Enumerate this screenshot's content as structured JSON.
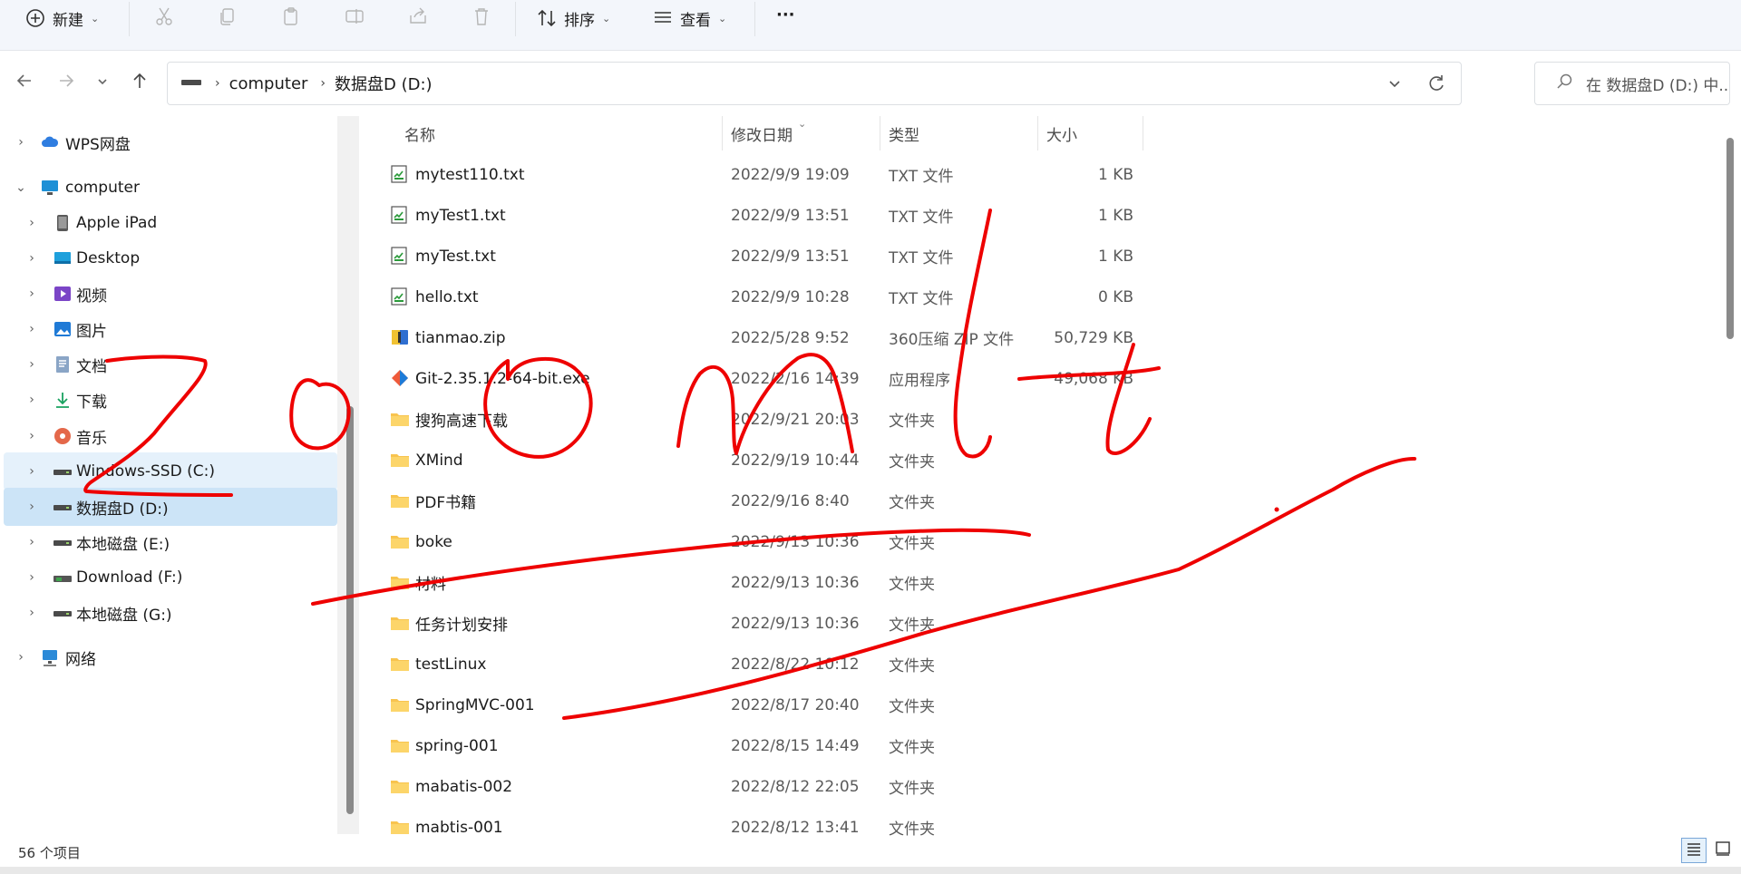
{
  "toolbar": {
    "new_label": "新建",
    "sort_label": "排序",
    "view_label": "查看",
    "more_label": "···"
  },
  "address": {
    "crumbs": [
      "computer",
      "数据盘D (D:)"
    ]
  },
  "search": {
    "placeholder": "在 数据盘D (D:) 中..."
  },
  "sidebar": {
    "items": [
      {
        "label": "WPS网盘",
        "icon": "cloud-icon",
        "level": 0,
        "chevron": "›"
      },
      {
        "label": "computer",
        "icon": "monitor-icon",
        "level": 0,
        "chevron": "⌄"
      },
      {
        "label": "Apple iPad",
        "icon": "ipad-icon",
        "level": 1,
        "chevron": "›"
      },
      {
        "label": "Desktop",
        "icon": "desktop-icon",
        "level": 1,
        "chevron": "›"
      },
      {
        "label": "视频",
        "icon": "video-icon",
        "level": 1,
        "chevron": "›"
      },
      {
        "label": "图片",
        "icon": "picture-icon",
        "level": 1,
        "chevron": "›"
      },
      {
        "label": "文档",
        "icon": "document-icon",
        "level": 1,
        "chevron": "›"
      },
      {
        "label": "下载",
        "icon": "download-icon",
        "level": 1,
        "chevron": "›"
      },
      {
        "label": "音乐",
        "icon": "music-icon",
        "level": 1,
        "chevron": "›"
      },
      {
        "label": "Windows-SSD (C:)",
        "icon": "drive-icon",
        "level": 1,
        "chevron": "›"
      },
      {
        "label": "数据盘D (D:)",
        "icon": "drive-icon",
        "level": 1,
        "chevron": "›"
      },
      {
        "label": "本地磁盘 (E:)",
        "icon": "drive-icon",
        "level": 1,
        "chevron": "›"
      },
      {
        "label": "Download (F:)",
        "icon": "usb-drive-icon",
        "level": 1,
        "chevron": "›"
      },
      {
        "label": "本地磁盘 (G:)",
        "icon": "drive-icon",
        "level": 1,
        "chevron": "›"
      },
      {
        "label": "网络",
        "icon": "network-icon",
        "level": 0,
        "chevron": "›"
      }
    ]
  },
  "columns": {
    "name": "名称",
    "modified": "修改日期",
    "type": "类型",
    "size": "大小"
  },
  "files": [
    {
      "name": "mytest110.txt",
      "date": "2022/9/9 19:09",
      "type": "TXT 文件",
      "size": "1 KB",
      "kind": "txt"
    },
    {
      "name": "myTest1.txt",
      "date": "2022/9/9 13:51",
      "type": "TXT 文件",
      "size": "1 KB",
      "kind": "txt"
    },
    {
      "name": "myTest.txt",
      "date": "2022/9/9 13:51",
      "type": "TXT 文件",
      "size": "1 KB",
      "kind": "txt"
    },
    {
      "name": "hello.txt",
      "date": "2022/9/9 10:28",
      "type": "TXT 文件",
      "size": "0 KB",
      "kind": "txt"
    },
    {
      "name": "tianmao.zip",
      "date": "2022/5/28 9:52",
      "type": "360压缩 ZIP 文件",
      "size": "50,729 KB",
      "kind": "zip"
    },
    {
      "name": "Git-2.35.1.2-64-bit.exe",
      "date": "2022/2/16 14:39",
      "type": "应用程序",
      "size": "49,068 KB",
      "kind": "exe"
    },
    {
      "name": "搜狗高速下载",
      "date": "2022/9/21 20:03",
      "type": "文件夹",
      "size": "",
      "kind": "folder"
    },
    {
      "name": "XMind",
      "date": "2022/9/19 10:44",
      "type": "文件夹",
      "size": "",
      "kind": "folder"
    },
    {
      "name": "PDF书籍",
      "date": "2022/9/16 8:40",
      "type": "文件夹",
      "size": "",
      "kind": "folder"
    },
    {
      "name": "boke",
      "date": "2022/9/13 10:36",
      "type": "文件夹",
      "size": "",
      "kind": "folder"
    },
    {
      "name": "材料",
      "date": "2022/9/13 10:36",
      "type": "文件夹",
      "size": "",
      "kind": "folder"
    },
    {
      "name": "任务计划安排",
      "date": "2022/9/13 10:36",
      "type": "文件夹",
      "size": "",
      "kind": "folder"
    },
    {
      "name": "testLinux",
      "date": "2022/8/22 10:12",
      "type": "文件夹",
      "size": "",
      "kind": "folder"
    },
    {
      "name": "SpringMVC-001",
      "date": "2022/8/17 20:40",
      "type": "文件夹",
      "size": "",
      "kind": "folder"
    },
    {
      "name": "spring-001",
      "date": "2022/8/15 14:49",
      "type": "文件夹",
      "size": "",
      "kind": "folder"
    },
    {
      "name": "mabatis-002",
      "date": "2022/8/12 22:05",
      "type": "文件夹",
      "size": "",
      "kind": "folder"
    },
    {
      "name": "mabtis-001",
      "date": "2022/8/12 13:41",
      "type": "文件夹",
      "size": "",
      "kind": "folder"
    }
  ],
  "status": {
    "item_count": "56 个项目"
  },
  "colors": {
    "accent": "#0067c0",
    "selected_bg": "#cce4f7",
    "hover_bg": "#e5f1fb",
    "ink": "#ee0000",
    "folder": "#f8c44f"
  }
}
